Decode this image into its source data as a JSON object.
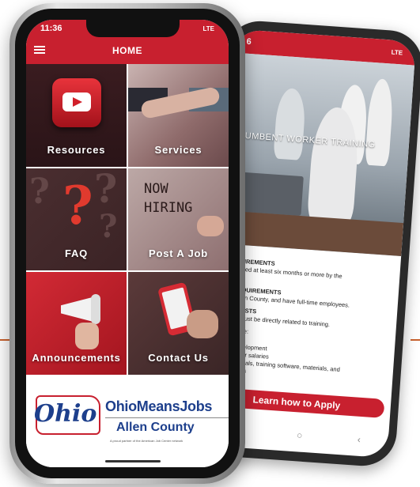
{
  "front": {
    "status": {
      "time": "11:36",
      "indicators": "LTE"
    },
    "appbar": {
      "title": "HOME"
    },
    "tiles": [
      {
        "label": "Resources"
      },
      {
        "label": "Services"
      },
      {
        "label": "FAQ"
      },
      {
        "label": "Post A Job"
      },
      {
        "label": "Announcements"
      },
      {
        "label": "Contact Us"
      }
    ],
    "poster_text": "NOW HIRING",
    "logo": {
      "script": "Ohio",
      "brand": "OhioMeansJobs",
      "county": "Allen County",
      "tagline": "A proud partner of the American Job Center network"
    }
  },
  "back": {
    "status": {
      "time": "6",
      "indicators": "LTE"
    },
    "photo_title": "INCUMBENT WORKER TRAINING",
    "lines": [
      {
        "text": "E REQUIREMENTS",
        "heading": true
      },
      {
        "text": "e employed at least six months or more by the",
        "heading": false
      },
      {
        "text": "s.",
        "heading": false
      },
      {
        "text": "YER REQUIREMENTS",
        "heading": true
      },
      {
        "text": "ing in Allen County, and have full-time employees.",
        "heading": false
      },
      {
        "text": "ABLE COSTS",
        "heading": true
      },
      {
        "text": "le costs must be directly related to training.",
        "heading": false
      },
      {
        "text": "nay include:",
        "heading": false
      },
      {
        "text": "n",
        "heading": false
      },
      {
        "text": "culum development",
        "heading": false
      },
      {
        "text": "uctor/trainer salaries",
        "heading": false
      },
      {
        "text": "ooks, manuals, training software, materials, and",
        "heading": false
      },
      {
        "text": "onsumables",
        "heading": false
      }
    ],
    "apply_label": "Learn how to Apply",
    "nav": [
      "|||",
      "○",
      "‹"
    ]
  },
  "colors": {
    "brand_red": "#c8202f",
    "brand_blue": "#1d3f8c"
  },
  "icons": [
    "menu-icon",
    "youtube-play-icon",
    "megaphone-icon"
  ]
}
